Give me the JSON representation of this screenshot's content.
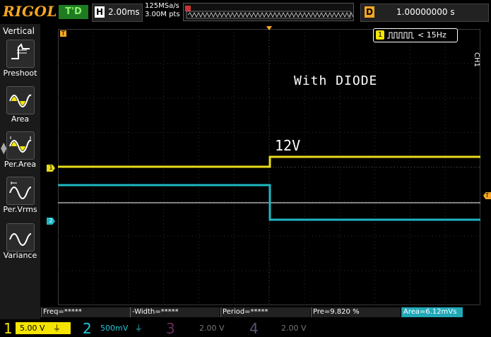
{
  "header": {
    "logo": "RIGOL",
    "trigger_status": "T'D",
    "horizontal_label": "H",
    "timebase": "2.00ms",
    "sample_rate": "125MSa/s",
    "memory_depth": "3.00M pts",
    "delay_label": "D",
    "delay_value": "1.00000000 s"
  },
  "menu": {
    "title": "Vertical",
    "items": [
      {
        "label": "Preshoot",
        "icon": "preshoot-icon"
      },
      {
        "label": "Area",
        "icon": "area-icon"
      },
      {
        "label": "Per.Area",
        "icon": "per-area-icon"
      },
      {
        "label": "Per.Vrms",
        "icon": "per-vrms-icon"
      },
      {
        "label": "Variance",
        "icon": "variance-icon"
      }
    ]
  },
  "screen": {
    "annotation": "With DIODE",
    "voltage_label": "12V",
    "frequency_badge": "< 15Hz",
    "frequency_badge_channel": "1",
    "side_label": "CH1",
    "trigger_marker": "T",
    "ch1_marker": "1",
    "ch2_marker": "2"
  },
  "measurements": [
    "Freq=*****",
    "-Width=*****",
    "Period=*****",
    "Pre=9.820 %",
    "Area=6.12mVs"
  ],
  "channels": [
    {
      "num": "1",
      "scale": "5.00 V",
      "color": "#f5e400",
      "active": true
    },
    {
      "num": "2",
      "scale": "500mV",
      "color": "#21c8d8",
      "active": true
    },
    {
      "num": "3",
      "scale": "2.00 V",
      "color": "#6a2c5f",
      "active": false
    },
    {
      "num": "4",
      "scale": "2.00 V",
      "color": "#555577",
      "active": false
    }
  ],
  "colors": {
    "ch1": "#e8dc1c",
    "ch2": "#1fb7c4",
    "trigger": "#f5a623",
    "grid": "#2e2e2e"
  }
}
